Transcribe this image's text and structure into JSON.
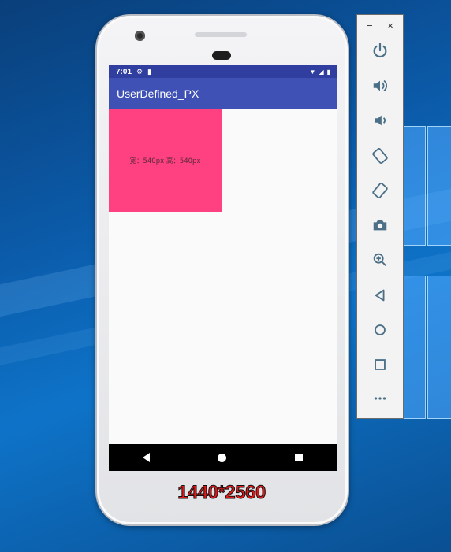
{
  "phone": {
    "status_time": "7:01",
    "app_title": "UserDefined_PX",
    "box_text": "宽：540px  高：540px",
    "nav": [
      "back",
      "home",
      "recents"
    ]
  },
  "caption": "1440*2560",
  "toolbar": {
    "minimize": "−",
    "close": "×",
    "buttons": [
      {
        "name": "power-icon",
        "label": "Power"
      },
      {
        "name": "volume-up-icon",
        "label": "Volume up"
      },
      {
        "name": "volume-down-icon",
        "label": "Volume down"
      },
      {
        "name": "rotate-left-icon",
        "label": "Rotate left"
      },
      {
        "name": "rotate-right-icon",
        "label": "Rotate right"
      },
      {
        "name": "camera-icon",
        "label": "Take screenshot"
      },
      {
        "name": "zoom-icon",
        "label": "Zoom"
      },
      {
        "name": "back-icon",
        "label": "Back"
      },
      {
        "name": "home-icon",
        "label": "Home"
      },
      {
        "name": "overview-icon",
        "label": "Overview"
      },
      {
        "name": "more-icon",
        "label": "More"
      }
    ]
  },
  "colors": {
    "statusbar": "#303f9f",
    "appbar": "#3f51b5",
    "accent_box": "#ff4081",
    "caption": "#e31919",
    "toolbar_icons": "#4a6f87"
  }
}
